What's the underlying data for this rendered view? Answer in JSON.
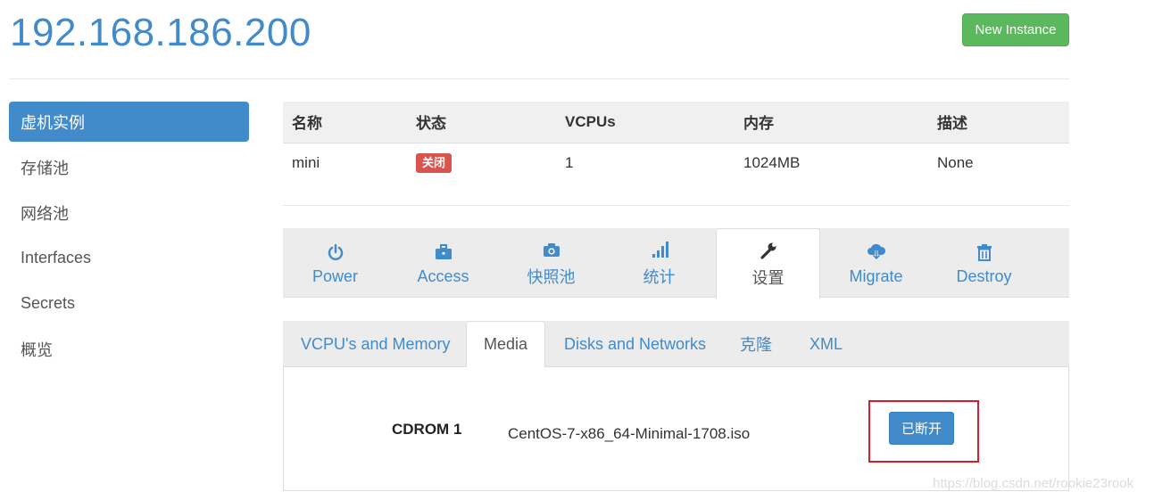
{
  "header": {
    "title": "192.168.186.200",
    "new_instance_label": "New Instance"
  },
  "sidebar": {
    "items": [
      {
        "label": "虚机实例",
        "active": true
      },
      {
        "label": "存储池"
      },
      {
        "label": "网络池"
      },
      {
        "label": "Interfaces"
      },
      {
        "label": "Secrets"
      },
      {
        "label": "概览"
      }
    ]
  },
  "instances_table": {
    "columns": [
      "名称",
      "状态",
      "VCPUs",
      "内存",
      "描述"
    ],
    "rows": [
      {
        "name": "mini",
        "status": "关闭",
        "vcpus": "1",
        "memory": "1024MB",
        "description": "None"
      }
    ]
  },
  "main_tabs": [
    {
      "label": "Power",
      "icon": "power-icon"
    },
    {
      "label": "Access",
      "icon": "briefcase-icon"
    },
    {
      "label": "快照池",
      "icon": "camera-icon"
    },
    {
      "label": "统计",
      "icon": "signal-bars-icon"
    },
    {
      "label": "设置",
      "icon": "wrench-icon",
      "active": true
    },
    {
      "label": "Migrate",
      "icon": "cloud-download-icon"
    },
    {
      "label": "Destroy",
      "icon": "trash-icon"
    }
  ],
  "sub_tabs": [
    {
      "label": "VCPU's and Memory"
    },
    {
      "label": "Media",
      "active": true
    },
    {
      "label": "Disks and Networks"
    },
    {
      "label": "克隆"
    },
    {
      "label": "XML"
    }
  ],
  "media": {
    "cdrom_label": "CDROM 1",
    "cdrom_value": "CentOS-7-x86_64-Minimal-1708.iso",
    "disconnect_label": "已断开"
  },
  "watermark": "https://blog.csdn.net/rookie23rook",
  "colors": {
    "primary": "#428bca",
    "success": "#5cb85c",
    "danger": "#d9534f",
    "highlight_box": "#d0202f"
  }
}
